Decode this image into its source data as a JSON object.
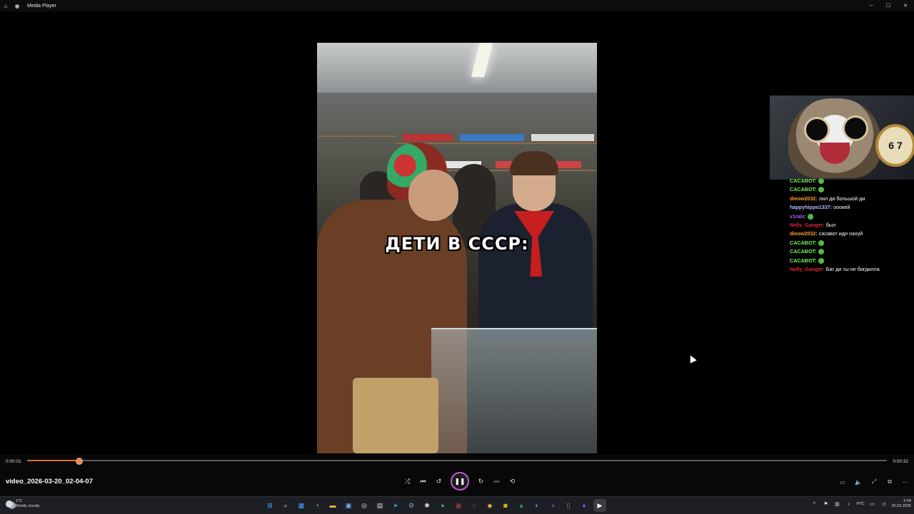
{
  "titlebar": {
    "app_title": "Media Player"
  },
  "video": {
    "caption": "ДЕТИ В СССР:"
  },
  "cat_overlay": {
    "watch_text": "6 7"
  },
  "chat": [
    {
      "user": "CACABOT:",
      "color": "#7cf25a",
      "text": "",
      "emote": true
    },
    {
      "user": "CACABOT:",
      "color": "#7cf25a",
      "text": "",
      "emote": true
    },
    {
      "user": "dieow2032:",
      "color": "#ff9a2b",
      "text": "лил ди большой ди",
      "emote": false
    },
    {
      "user": "happyhippo1337:",
      "color": "#b6b9ff",
      "text": "ооокей",
      "emote": false
    },
    {
      "user": "v1ralx:",
      "color": "#b45cff",
      "text": "",
      "emote": true
    },
    {
      "user": "Nelly_Ganger:",
      "color": "#e0243a",
      "text": "был",
      "emote": false
    },
    {
      "user": "dieow2032:",
      "color": "#ff9a2b",
      "text": "сасавот иди нахуй",
      "emote": false
    },
    {
      "user": "CACABOT:",
      "color": "#7cf25a",
      "text": "",
      "emote": true
    },
    {
      "user": "CACABOT:",
      "color": "#7cf25a",
      "text": "",
      "emote": true
    },
    {
      "user": "CACABOT:",
      "color": "#7cf25a",
      "text": "",
      "emote": true
    },
    {
      "user": "Nelly_Ganger:",
      "color": "#e0243a",
      "text": "Биг ди ты не бигдилла",
      "emote": false
    }
  ],
  "player": {
    "current_time": "0:00:01",
    "total_time": "0:00:32",
    "progress": 0.06,
    "file_name": "video_2026-03-20_02-04-07",
    "accent_color": "#d86b3e"
  },
  "taskbar": {
    "weather_temp": "1°C",
    "weather_desc": "Mostly cloudy",
    "language": "РУС",
    "time": "2:04",
    "date": "20.03.2026"
  }
}
